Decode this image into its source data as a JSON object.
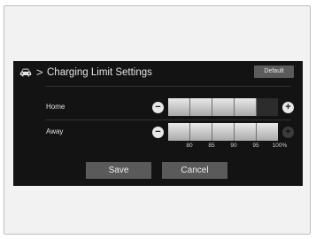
{
  "header": {
    "icon": "car-icon",
    "separator_glyph": ">",
    "title": "Charging Limit Settings",
    "default_label": "Default"
  },
  "rows": [
    {
      "label": "Home",
      "level_percent": 95,
      "minus_glyph": "−",
      "plus_glyph": "+",
      "plus_enabled": true
    },
    {
      "label": "Away",
      "level_percent": 100,
      "minus_glyph": "−",
      "plus_glyph": "+",
      "plus_enabled": false
    }
  ],
  "scale_ticks": [
    "80",
    "85",
    "90",
    "95",
    "100%"
  ],
  "buttons": {
    "save_label": "Save",
    "cancel_label": "Cancel"
  },
  "colors": {
    "screen_bg": "#131313",
    "bar_fill": "#d8d8d8",
    "button_bg": "#5a5a5a"
  }
}
